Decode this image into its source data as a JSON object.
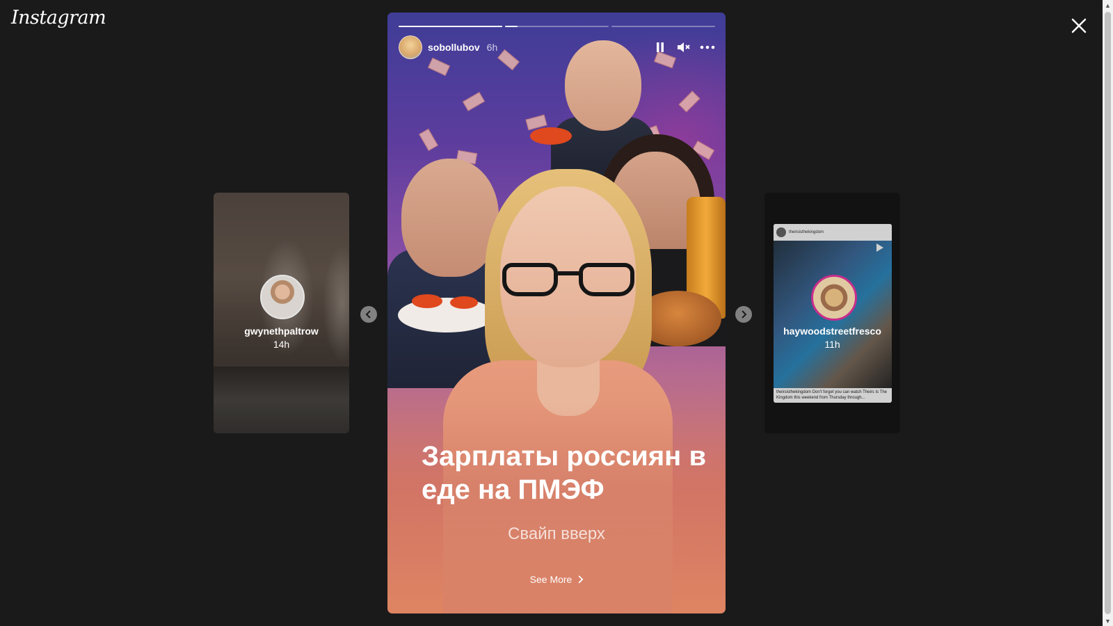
{
  "app": {
    "logo_text": "Instagram"
  },
  "story": {
    "username": "sobollubov",
    "time": "6h",
    "headline": "Зарплаты россиян в еде на ПМЭФ",
    "swipe_text": "Свайп вверх",
    "see_more": "See More",
    "progress": [
      1,
      0.12,
      0
    ]
  },
  "prev_story": {
    "username": "gwynethpaltrow",
    "time": "14h"
  },
  "next_story": {
    "username": "haywoodstreetfresco",
    "time": "11h",
    "post_account": "theirsisthekingdom",
    "post_caption": "theirsisthekingdom Don't forget you can watch Theirs Is The Kingdom this weekend from Thursday through..."
  }
}
